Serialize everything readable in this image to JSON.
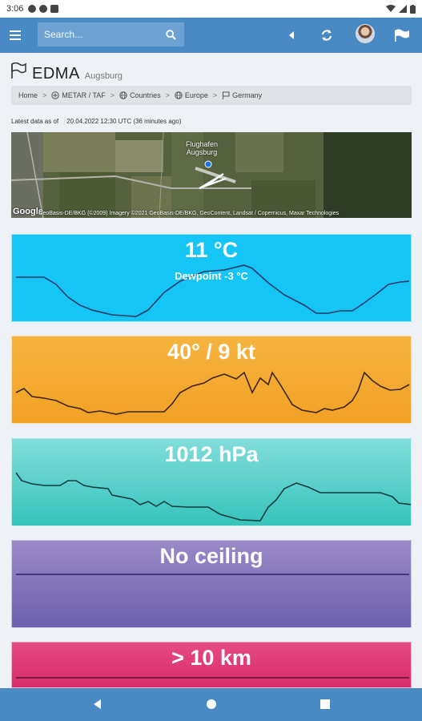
{
  "status_bar": {
    "time": "3:06"
  },
  "appbar": {
    "search_placeholder": "Search...",
    "icons": [
      "menu-icon",
      "search-icon",
      "collapse-left-icon",
      "refresh-icon",
      "avatar",
      "flag-icon"
    ]
  },
  "station": {
    "code": "EDMA",
    "city": "Augsburg"
  },
  "breadcrumb": [
    {
      "label": "Home",
      "icon": ""
    },
    {
      "label": "METAR / TAF",
      "icon": "plane-icon"
    },
    {
      "label": "Countries",
      "icon": "globe-icon"
    },
    {
      "label": "Europe",
      "icon": "globe-icon"
    },
    {
      "label": "Germany",
      "icon": "flag-icon"
    }
  ],
  "latest": {
    "prefix": "Latest data as of",
    "value": "20.04.2022 12:30 UTC (36 minutes ago)"
  },
  "map": {
    "label_line1": "Flughafen",
    "label_line2": "Augsburg",
    "google": "Google",
    "attribution": "GeoBasis-DE/BKG (©2009) Imagery ©2021 GeoBasis-DE/BKG, GeoContent, Landsat / Copernicus, Maxar Technologies"
  },
  "cards": {
    "temperature": {
      "value": "11 °C",
      "sub": "Dewpoint -3 °C"
    },
    "wind": {
      "value": "40° / 9 kt"
    },
    "pressure": {
      "value": "1012 hPa"
    },
    "ceiling": {
      "value": "No ceiling"
    },
    "visibility": {
      "value": "> 10 km"
    }
  },
  "colors": {
    "appbar": "#4a8ac4",
    "temperature": "#15c5f5",
    "wind": "#f2a024",
    "pressure": "#35c3bc",
    "ceiling": "#6d60ae",
    "visibility": "#d82b6b"
  }
}
